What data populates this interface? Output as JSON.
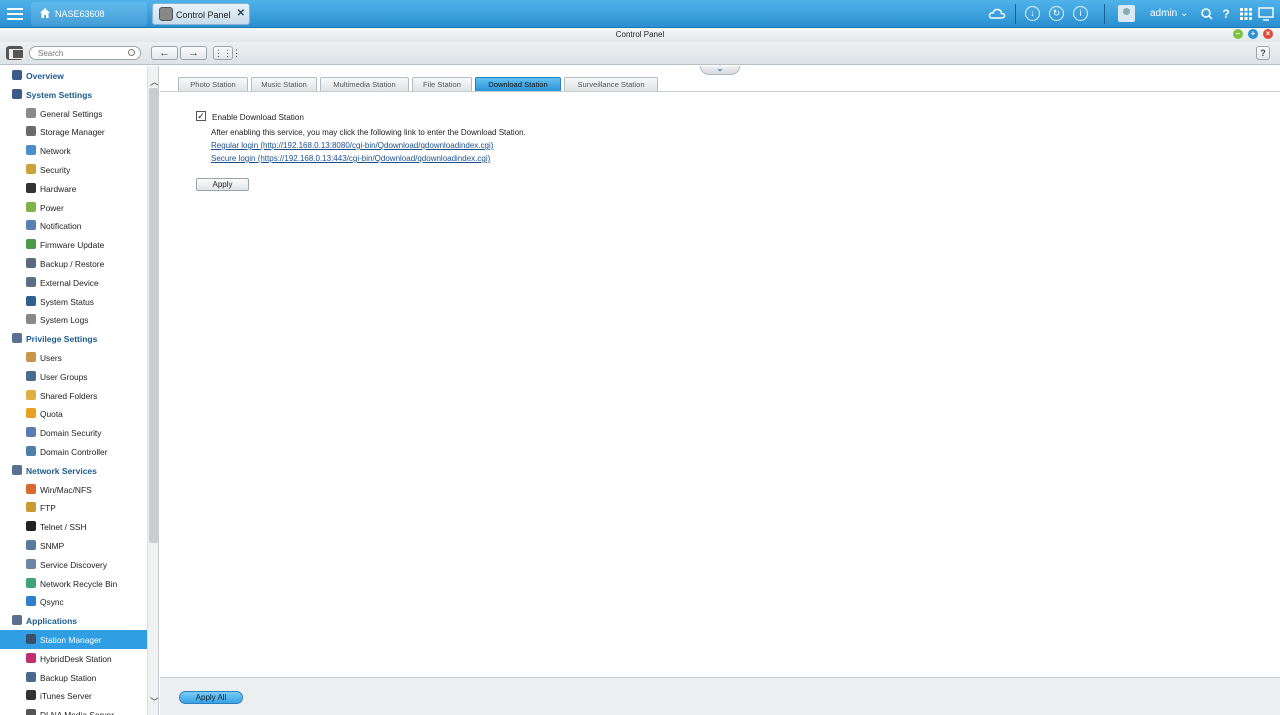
{
  "topbar": {
    "nas_name": "NASE63608",
    "window_tab": "Control Panel",
    "user": "admin",
    "icons": [
      "cloud-icon",
      "clock-icon",
      "sync-icon",
      "info-icon",
      "user-icon",
      "search-icon",
      "help-icon",
      "apps-grid-icon",
      "monitor-icon"
    ]
  },
  "window": {
    "title": "Control Panel"
  },
  "toolbar": {
    "search_placeholder": "Search",
    "back_glyph": "←",
    "forward_glyph": "→",
    "help_glyph": "?"
  },
  "sidebar": {
    "items": [
      {
        "type": "section",
        "label": "Overview",
        "color": "#3b5b8a"
      },
      {
        "type": "section",
        "label": "System Settings",
        "color": "#3b5b8a"
      },
      {
        "type": "item",
        "label": "General Settings",
        "color": "#8a8a8a"
      },
      {
        "type": "item",
        "label": "Storage Manager",
        "color": "#6b6b6b"
      },
      {
        "type": "item",
        "label": "Network",
        "color": "#4c8fc8"
      },
      {
        "type": "item",
        "label": "Security",
        "color": "#c9a33a"
      },
      {
        "type": "item",
        "label": "Hardware",
        "color": "#333333"
      },
      {
        "type": "item",
        "label": "Power",
        "color": "#7fb34a"
      },
      {
        "type": "item",
        "label": "Notification",
        "color": "#5a7fb5"
      },
      {
        "type": "item",
        "label": "Firmware Update",
        "color": "#4a9a4a"
      },
      {
        "type": "item",
        "label": "Backup / Restore",
        "color": "#5a6b80"
      },
      {
        "type": "item",
        "label": "External Device",
        "color": "#5d6f82"
      },
      {
        "type": "item",
        "label": "System Status",
        "color": "#2f5f8f"
      },
      {
        "type": "item",
        "label": "System Logs",
        "color": "#888888"
      },
      {
        "type": "section",
        "label": "Privilege Settings",
        "color": "#5a7090"
      },
      {
        "type": "item",
        "label": "Users",
        "color": "#c8954a"
      },
      {
        "type": "item",
        "label": "User Groups",
        "color": "#4d6b8f"
      },
      {
        "type": "item",
        "label": "Shared Folders",
        "color": "#e0b040"
      },
      {
        "type": "item",
        "label": "Quota",
        "color": "#e8a020"
      },
      {
        "type": "item",
        "label": "Domain Security",
        "color": "#5b7cae"
      },
      {
        "type": "item",
        "label": "Domain Controller",
        "color": "#4f7fa8"
      },
      {
        "type": "section",
        "label": "Network Services",
        "color": "#5a7090"
      },
      {
        "type": "item",
        "label": "Win/Mac/NFS",
        "color": "#d86a30"
      },
      {
        "type": "item",
        "label": "FTP",
        "color": "#c89a30"
      },
      {
        "type": "item",
        "label": "Telnet / SSH",
        "color": "#222222"
      },
      {
        "type": "item",
        "label": "SNMP",
        "color": "#5a7b9f"
      },
      {
        "type": "item",
        "label": "Service Discovery",
        "color": "#6b85a8"
      },
      {
        "type": "item",
        "label": "Network Recycle Bin",
        "color": "#3fa37a"
      },
      {
        "type": "item",
        "label": "Qsync",
        "color": "#2f7fcf"
      },
      {
        "type": "section",
        "label": "Applications",
        "color": "#5a7090"
      },
      {
        "type": "item",
        "label": "Station Manager",
        "color": "#3a4f6a",
        "active": true
      },
      {
        "type": "item",
        "label": "HybridDesk Station",
        "color": "#c03070"
      },
      {
        "type": "item",
        "label": "Backup Station",
        "color": "#4a6a8a"
      },
      {
        "type": "item",
        "label": "iTunes Server",
        "color": "#333333"
      },
      {
        "type": "item",
        "label": "DLNA Media Server",
        "color": "#555555"
      }
    ]
  },
  "tabs": [
    {
      "label": "Photo Station",
      "active": false
    },
    {
      "label": "Music Station",
      "active": false
    },
    {
      "label": "Multimedia Station",
      "active": false
    },
    {
      "label": "File Station",
      "active": false
    },
    {
      "label": "Download Station",
      "active": true
    },
    {
      "label": "Surveillance Station",
      "active": false
    }
  ],
  "content": {
    "enable_label": "Enable Download Station",
    "enabled": true,
    "description": "After enabling this service, you may click the following link to enter the Download Station.",
    "regular_login": "Regular login (http://192.168.0.13:8080/cgi-bin/Qdownload/qdownloadindex.cgi)",
    "secure_login": "Secure login (https://192.168.0.13:443/cgi-bin/Qdownload/qdownloadindex.cgi)",
    "apply_label": "Apply"
  },
  "footer": {
    "apply_all_label": "Apply All"
  },
  "colors": {
    "accent": "#2f9ee3",
    "topbar": "#3aa0df"
  }
}
